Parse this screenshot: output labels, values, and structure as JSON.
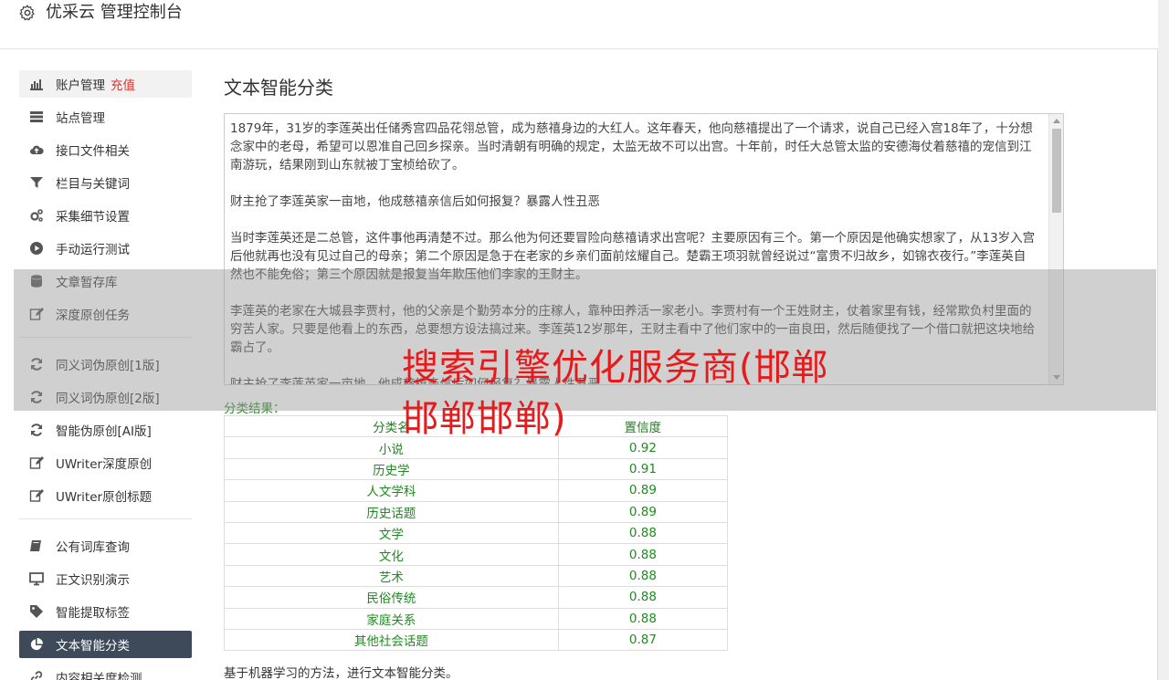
{
  "header": {
    "title": "优采云 管理控制台"
  },
  "sidebar": {
    "group1": [
      {
        "label": "账户管理",
        "extra": "充值",
        "icon": "bar-chart-icon"
      },
      {
        "label": "站点管理",
        "icon": "server-icon"
      },
      {
        "label": "接口文件相关",
        "icon": "cloud-upload-icon"
      },
      {
        "label": "栏目与关键词",
        "icon": "filter-icon"
      },
      {
        "label": "采集细节设置",
        "icon": "gears-icon"
      },
      {
        "label": "手动运行测试",
        "icon": "play-circle-icon"
      },
      {
        "label": "文章暂存库",
        "icon": "database-icon"
      },
      {
        "label": "深度原创任务",
        "icon": "edit-icon"
      }
    ],
    "group2": [
      {
        "label": "同义词伪原创[1版]",
        "icon": "refresh-icon"
      },
      {
        "label": "同义词伪原创[2版]",
        "icon": "refresh-icon"
      },
      {
        "label": "智能伪原创[AI版]",
        "icon": "refresh-icon"
      },
      {
        "label": "UWriter深度原创",
        "icon": "edit-icon"
      },
      {
        "label": "UWriter原创标题",
        "icon": "edit-icon"
      }
    ],
    "group3": [
      {
        "label": "公有词库查询",
        "icon": "book-icon"
      },
      {
        "label": "正文识别演示",
        "icon": "monitor-icon"
      },
      {
        "label": "智能提取标签",
        "icon": "tag-icon"
      },
      {
        "label": "文本智能分类",
        "icon": "pie-chart-icon"
      },
      {
        "label": "内容相关度检测",
        "icon": "link-icon"
      }
    ]
  },
  "main": {
    "title": "文本智能分类",
    "article": [
      "1879年，31岁的李莲英出任储秀宫四品花翎总管，成为慈禧身边的大红人。这年春天，他向慈禧提出了一个请求，说自己已经入宫18年了，十分想念家中的老母，希望可以恩准自己回乡探亲。当时清朝有明确的规定，太监无故不可以出宫。十年前，时任大总管太监的安德海仗着慈禧的宠信到江南游玩，结果刚到山东就被丁宝桢给砍了。",
      "财主抢了李莲英家一亩地，他成慈禧亲信后如何报复？暴露人性丑恶",
      "当时李莲英还是二总管，这件事他再清楚不过。那么他为何还要冒险向慈禧请求出宫呢？主要原因有三个。第一个原因是他确实想家了，从13岁入宫后他就再也没有见过自己的母亲；第二个原因是急于在老家的乡亲们面前炫耀自己。楚霸王项羽就曾经说过“富贵不归故乡，如锦衣夜行。”李莲英自然也不能免俗；第三个原因就是报复当年欺压他们李家的王财主。",
      "李莲英的老家在大城县李贾村，他的父亲是个勤劳本分的庄稼人，靠种田养活一家老小。李贾村有一个王姓财主，仗着家里有钱，经常欺负村里面的穷苦人家。只要是他看上的东西，总要想方设法搞过来。李莲英12岁那年，王财主看中了他们家中的一亩良田，然后随便找了一个借口就把这块地给霸占了。",
      "财主抢了李莲英家一亩地，他成慈禧亲信后如何报复？暴露人性丑恶"
    ],
    "result_label": "分类结果：",
    "table": {
      "headers": [
        "分类名",
        "置信度"
      ],
      "rows": [
        [
          "小说",
          "0.92"
        ],
        [
          "历史学",
          "0.91"
        ],
        [
          "人文学科",
          "0.89"
        ],
        [
          "历史话题",
          "0.89"
        ],
        [
          "文学",
          "0.88"
        ],
        [
          "文化",
          "0.88"
        ],
        [
          "艺术",
          "0.88"
        ],
        [
          "民俗传统",
          "0.88"
        ],
        [
          "家庭关系",
          "0.88"
        ],
        [
          "其他社会话题",
          "0.87"
        ]
      ]
    },
    "footnote": "基于机器学习的方法，进行文本智能分类。"
  },
  "watermark": {
    "text": "搜索引擎优化服务商(邯郸邯郸邯郸)"
  },
  "colors": {
    "accent_red": "#e8191b",
    "nav_active": "#3e4a5a",
    "result_green": "#1f8a1f"
  }
}
